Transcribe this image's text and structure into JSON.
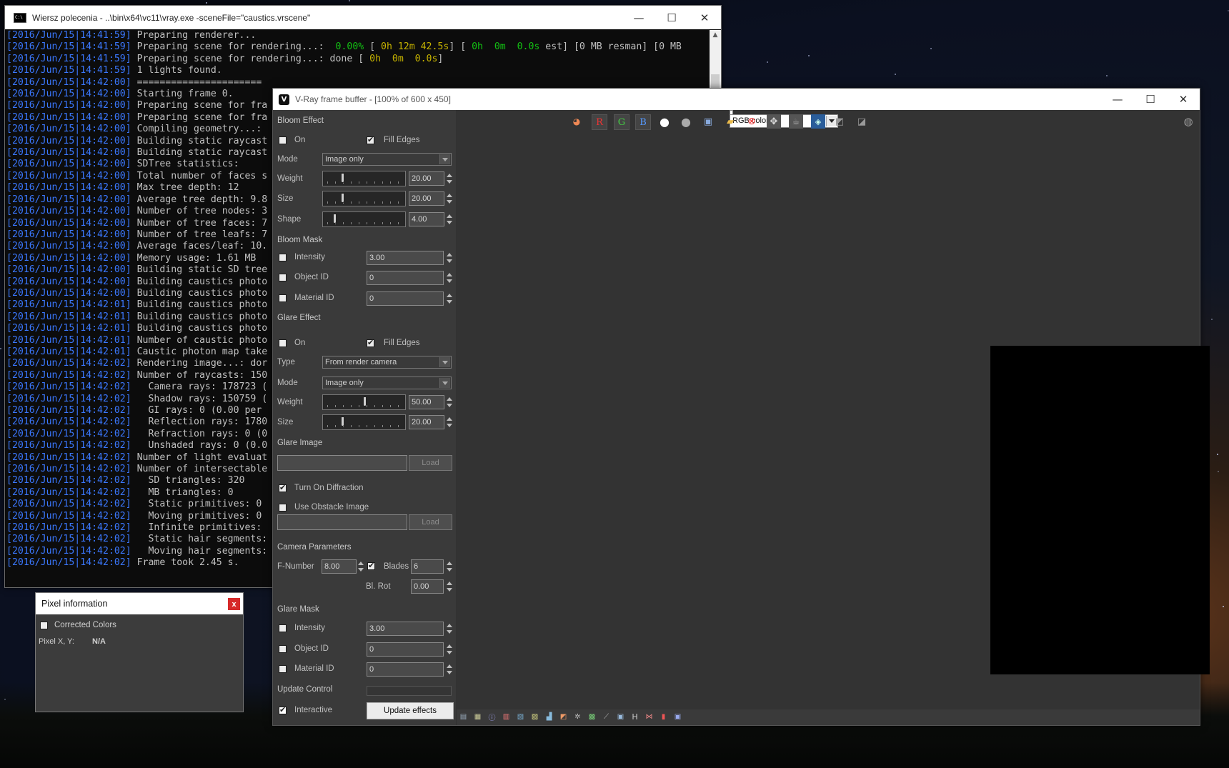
{
  "cmd": {
    "title": "Wiersz polecenia - ..\\bin\\x64\\vc11\\vray.exe  -sceneFile=\"caustics.vrscene\"",
    "lines": [
      {
        "ts": "[2016/Jun/15|14:41:59]",
        "msg": " Preparing renderer..."
      },
      {
        "ts": "[2016/Jun/15|14:41:59]",
        "msg": " Preparing scene for rendering...:  ",
        "pct": "0.00%",
        "rest1": " [ ",
        "t1": "0h 12m 42.5s",
        "rest2": "] [ ",
        "t2": "0h  0m  0.0s",
        "rest3": " est] [0 MB resman] [0 MB"
      },
      {
        "ts": "[2016/Jun/15|14:41:59]",
        "msg": " Preparing scene for rendering...: done [ ",
        "t1": "0h  0m  0.0s",
        "rest2": "]"
      },
      {
        "ts": "[2016/Jun/15|14:41:59]",
        "msg": " 1 lights found."
      },
      {
        "ts": "[2016/Jun/15|14:42:00]",
        "msg": " ======================"
      },
      {
        "ts": "[2016/Jun/15|14:42:00]",
        "msg": " Starting frame 0."
      },
      {
        "ts": "[2016/Jun/15|14:42:00]",
        "msg": " Preparing scene for fra"
      },
      {
        "ts": "[2016/Jun/15|14:42:00]",
        "msg": " Preparing scene for fra"
      },
      {
        "ts": "[2016/Jun/15|14:42:00]",
        "msg": " Compiling geometry...:"
      },
      {
        "ts": "[2016/Jun/15|14:42:00]",
        "msg": " Building static raycast"
      },
      {
        "ts": "[2016/Jun/15|14:42:00]",
        "msg": " Building static raycast"
      },
      {
        "ts": "[2016/Jun/15|14:42:00]",
        "msg": " SDTree statistics:"
      },
      {
        "ts": "[2016/Jun/15|14:42:00]",
        "msg": " Total number of faces s"
      },
      {
        "ts": "[2016/Jun/15|14:42:00]",
        "msg": " Max tree depth: 12"
      },
      {
        "ts": "[2016/Jun/15|14:42:00]",
        "msg": " Average tree depth: 9.8"
      },
      {
        "ts": "[2016/Jun/15|14:42:00]",
        "msg": " Number of tree nodes: 3"
      },
      {
        "ts": "[2016/Jun/15|14:42:00]",
        "msg": " Number of tree faces: 7"
      },
      {
        "ts": "[2016/Jun/15|14:42:00]",
        "msg": " Number of tree leafs: 7"
      },
      {
        "ts": "[2016/Jun/15|14:42:00]",
        "msg": " Average faces/leaf: 10."
      },
      {
        "ts": "[2016/Jun/15|14:42:00]",
        "msg": " Memory usage: 1.61 MB"
      },
      {
        "ts": "[2016/Jun/15|14:42:00]",
        "msg": " Building static SD tree"
      },
      {
        "ts": "[2016/Jun/15|14:42:00]",
        "msg": " Building caustics photo"
      },
      {
        "ts": "[2016/Jun/15|14:42:00]",
        "msg": " Building caustics photo"
      },
      {
        "ts": "[2016/Jun/15|14:42:01]",
        "msg": " Building caustics photo"
      },
      {
        "ts": "[2016/Jun/15|14:42:01]",
        "msg": " Building caustics photo"
      },
      {
        "ts": "[2016/Jun/15|14:42:01]",
        "msg": " Building caustics photo"
      },
      {
        "ts": "[2016/Jun/15|14:42:01]",
        "msg": " Number of caustic photo"
      },
      {
        "ts": "[2016/Jun/15|14:42:01]",
        "msg": " Caustic photon map take"
      },
      {
        "ts": "[2016/Jun/15|14:42:02]",
        "msg": " Rendering image...: dor"
      },
      {
        "ts": "[2016/Jun/15|14:42:02]",
        "msg": " Number of raycasts: 150"
      },
      {
        "ts": "[2016/Jun/15|14:42:02]",
        "msg": "   Camera rays: 178723 ("
      },
      {
        "ts": "[2016/Jun/15|14:42:02]",
        "msg": "   Shadow rays: 150759 ("
      },
      {
        "ts": "[2016/Jun/15|14:42:02]",
        "msg": "   GI rays: 0 (0.00 per"
      },
      {
        "ts": "[2016/Jun/15|14:42:02]",
        "msg": "   Reflection rays: 1780"
      },
      {
        "ts": "[2016/Jun/15|14:42:02]",
        "msg": "   Refraction rays: 0 (0"
      },
      {
        "ts": "[2016/Jun/15|14:42:02]",
        "msg": "   Unshaded rays: 0 (0.0"
      },
      {
        "ts": "[2016/Jun/15|14:42:02]",
        "msg": " Number of light evaluat"
      },
      {
        "ts": "[2016/Jun/15|14:42:02]",
        "msg": " Number of intersectable"
      },
      {
        "ts": "[2016/Jun/15|14:42:02]",
        "msg": "   SD triangles: 320"
      },
      {
        "ts": "[2016/Jun/15|14:42:02]",
        "msg": "   MB triangles: 0"
      },
      {
        "ts": "[2016/Jun/15|14:42:02]",
        "msg": "   Static primitives: 0"
      },
      {
        "ts": "[2016/Jun/15|14:42:02]",
        "msg": "   Moving primitives: 0"
      },
      {
        "ts": "[2016/Jun/15|14:42:02]",
        "msg": "   Infinite primitives:"
      },
      {
        "ts": "[2016/Jun/15|14:42:02]",
        "msg": "   Static hair segments:"
      },
      {
        "ts": "[2016/Jun/15|14:42:02]",
        "msg": "   Moving hair segments:"
      },
      {
        "ts": "[2016/Jun/15|14:42:02]",
        "msg": " Frame took 2.45 s."
      }
    ],
    "buttons": {
      "minimize": "—",
      "maximize": "☐",
      "close": "✕"
    }
  },
  "pixel_info": {
    "title": "Pixel information",
    "close": "x",
    "corrected_colors": "Corrected Colors",
    "pixel_xy_label": "Pixel X, Y:",
    "pixel_xy_value": "N/A"
  },
  "vfb": {
    "title": "V-Ray frame buffer - [100% of 600 x 450]",
    "buttons": {
      "minimize": "—",
      "maximize": "☐",
      "close": "✕"
    },
    "channel": "RGB color",
    "toolbar": {
      "r": "R",
      "g": "G",
      "b": "B"
    },
    "bloom": {
      "section": "Bloom Effect",
      "on": "On",
      "fill_edges": "Fill Edges",
      "mode_label": "Mode",
      "mode": "Image only",
      "weight_label": "Weight",
      "weight": "20.00",
      "weight_pos": 0.2,
      "size_label": "Size",
      "size": "20.00",
      "size_pos": 0.2,
      "shape_label": "Shape",
      "shape": "4.00",
      "shape_pos": 0.1
    },
    "bloom_mask": {
      "section": "Bloom Mask",
      "intensity_label": "Intensity",
      "intensity": "3.00",
      "object_id_label": "Object ID",
      "object_id": "0",
      "material_id_label": "Material ID",
      "material_id": "0"
    },
    "glare": {
      "section": "Glare Effect",
      "on": "On",
      "fill_edges": "Fill Edges",
      "type_label": "Type",
      "type": "From render camera",
      "mode_label": "Mode",
      "mode": "Image only",
      "weight_label": "Weight",
      "weight": "50.00",
      "weight_pos": 0.5,
      "size_label": "Size",
      "size": "20.00",
      "size_pos": 0.2
    },
    "glare_image": {
      "section": "Glare Image",
      "load": "Load",
      "turn_on_diffraction": "Turn On Diffraction",
      "use_obstacle_image": "Use Obstacle Image",
      "load2": "Load"
    },
    "camera": {
      "section": "Camera Parameters",
      "fnumber_label": "F-Number",
      "fnumber": "8.00",
      "blades_label": "Blades",
      "blades": "6",
      "blrot_label": "Bl. Rot",
      "blrot": "0.00"
    },
    "glare_mask": {
      "section": "Glare Mask",
      "intensity_label": "Intensity",
      "intensity": "3.00",
      "object_id_label": "Object ID",
      "object_id": "0",
      "material_id_label": "Material ID",
      "material_id": "0"
    },
    "update": {
      "section": "Update Control",
      "interactive": "Interactive",
      "update_effects": "Update effects"
    }
  }
}
